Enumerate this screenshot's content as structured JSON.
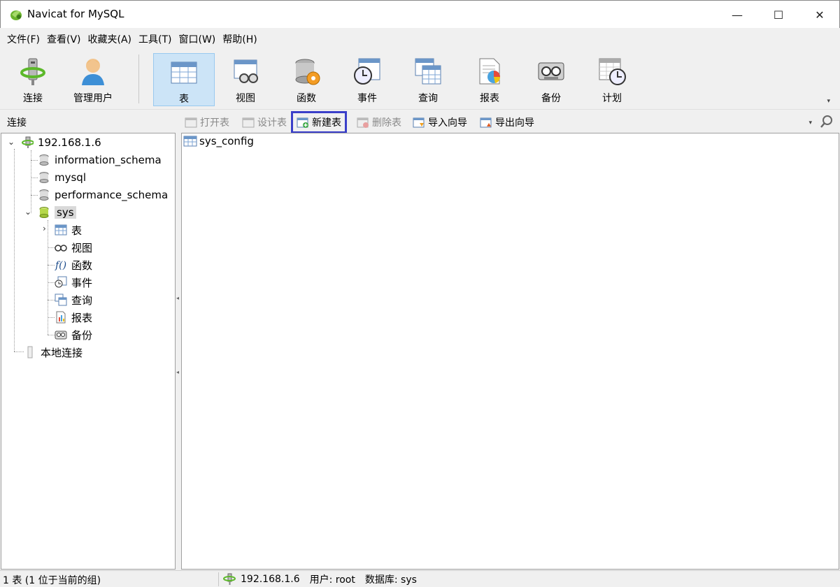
{
  "window": {
    "title": "Navicat for MySQL"
  },
  "window_controls": {
    "minimize": "—",
    "maximize": "☐",
    "close": "✕"
  },
  "menu": [
    "文件(F)",
    "查看(V)",
    "收藏夹(A)",
    "工具(T)",
    "窗口(W)",
    "帮助(H)"
  ],
  "toolbar": {
    "items": [
      {
        "label": "连接",
        "icon": "connection-icon"
      },
      {
        "label": "管理用户",
        "icon": "user-icon"
      },
      {
        "label": "表",
        "icon": "table-icon",
        "active": true
      },
      {
        "label": "视图",
        "icon": "view-icon"
      },
      {
        "label": "函数",
        "icon": "function-icon"
      },
      {
        "label": "事件",
        "icon": "event-icon"
      },
      {
        "label": "查询",
        "icon": "query-icon"
      },
      {
        "label": "报表",
        "icon": "report-icon"
      },
      {
        "label": "备份",
        "icon": "backup-icon"
      },
      {
        "label": "计划",
        "icon": "schedule-icon"
      }
    ]
  },
  "subtoolbar": {
    "section_label": "连接",
    "buttons": [
      {
        "label": "打开表",
        "enabled": false
      },
      {
        "label": "设计表",
        "enabled": false
      },
      {
        "label": "新建表",
        "enabled": true,
        "highlighted": true
      },
      {
        "label": "删除表",
        "enabled": false
      },
      {
        "label": "导入向导",
        "enabled": true
      },
      {
        "label": "导出向导",
        "enabled": true
      }
    ]
  },
  "tree": {
    "connection": "192.168.1.6",
    "databases": [
      "information_schema",
      "mysql",
      "performance_schema",
      "sys"
    ],
    "selected_db": "sys",
    "sys_children": [
      "表",
      "视图",
      "函数",
      "事件",
      "查询",
      "报表",
      "备份"
    ],
    "other_connection": "本地连接"
  },
  "content": {
    "objects": [
      "sys_config"
    ]
  },
  "status": {
    "left": "1 表 (1 位于当前的组)",
    "host": "192.168.1.6",
    "user": "用户: root",
    "database": "数据库: sys"
  },
  "colors": {
    "active_tab_bg": "#cce4f7",
    "highlight_outline": "#3a3fc9"
  }
}
